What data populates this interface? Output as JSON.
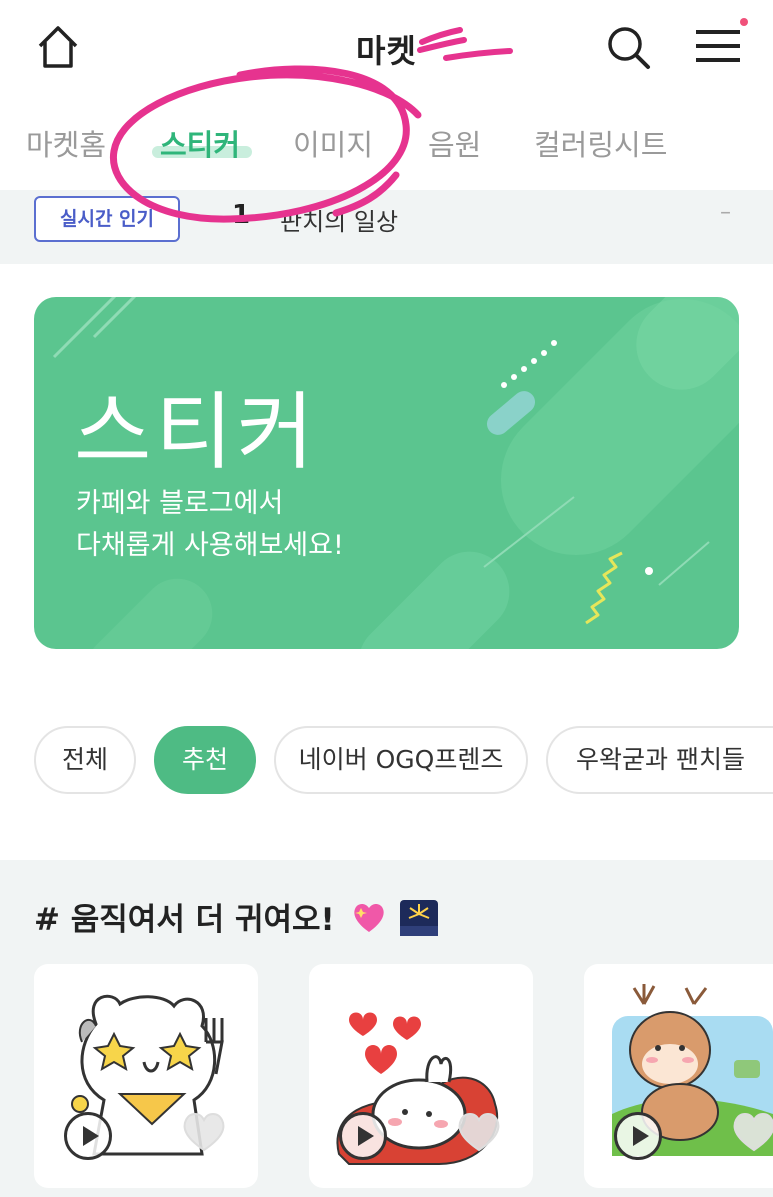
{
  "header": {
    "title": "마켓",
    "home_icon": "home-icon",
    "search_icon": "search-icon",
    "menu_icon": "hamburger-menu-icon",
    "notification_color": "#f0517a"
  },
  "tabs": [
    {
      "label": "마켓홈",
      "active": false
    },
    {
      "label": "스티커",
      "active": true
    },
    {
      "label": "이미지",
      "active": false
    },
    {
      "label": "음원",
      "active": false
    },
    {
      "label": "컬러링시트",
      "active": false
    }
  ],
  "realtime": {
    "badge": "실시간 인기",
    "rank": "1",
    "item": "판치의 일상",
    "change": "–"
  },
  "banner": {
    "title": "스티커",
    "line1": "카페와 블로그에서",
    "line2": "다채롭게 사용해보세요!",
    "color": "#5bc58f"
  },
  "chips": [
    {
      "label": "전체",
      "active": false
    },
    {
      "label": "추천",
      "active": true
    },
    {
      "label": "네이버 OGQ프렌즈",
      "active": false
    },
    {
      "label": "우왁굳과 팬치들",
      "active": false
    }
  ],
  "section": {
    "title": "# 움직여서 더 귀여오!",
    "cards": [
      {
        "name": "bear-sticker",
        "play_icon": "play-icon",
        "fav_icon": "heart-icon"
      },
      {
        "name": "bunny-sticker",
        "play_icon": "play-icon",
        "fav_icon": "heart-icon"
      },
      {
        "name": "deer-sticker",
        "play_icon": "play-icon",
        "fav_icon": "heart-icon"
      }
    ]
  },
  "colors": {
    "accent": "#2fb57a",
    "chip_active": "#4ebb84",
    "badge": "#4a5dc8",
    "annotation": "#e6338f"
  }
}
